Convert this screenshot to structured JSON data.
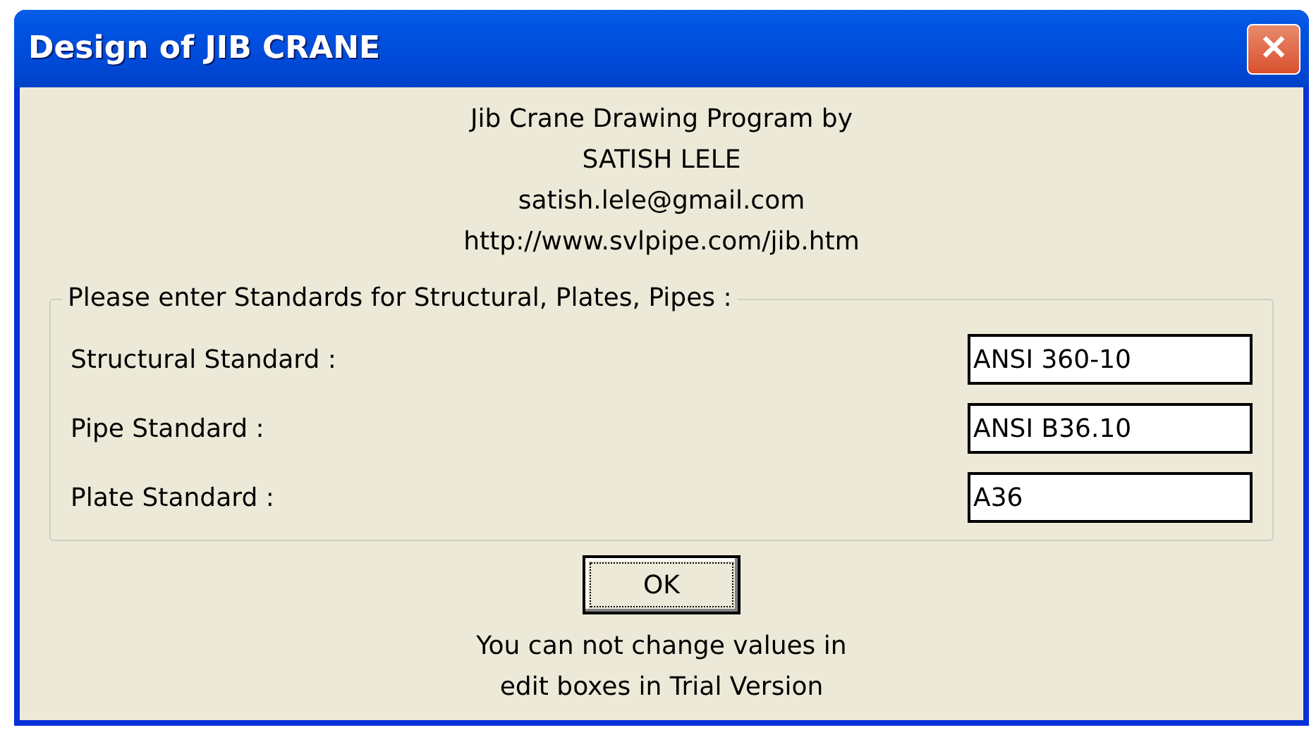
{
  "window": {
    "title": "Design of JIB CRANE",
    "close_label": "✕"
  },
  "header_lines": [
    "Jib Crane Drawing Program by",
    "SATISH LELE",
    "satish.lele@gmail.com",
    "http://www.svlpipe.com/jib.htm"
  ],
  "group": {
    "title": "Please enter Standards for Structural, Plates, Pipes :",
    "fields": [
      {
        "label": "Structural Standard :",
        "value": "ANSI 360-10"
      },
      {
        "label": "Pipe Standard :",
        "value": "ANSI B36.10"
      },
      {
        "label": "Plate Standard :",
        "value": "A36"
      }
    ]
  },
  "ok_button": "OK",
  "notice_lines": [
    "You can not change values in",
    "edit boxes in Trial Version"
  ]
}
